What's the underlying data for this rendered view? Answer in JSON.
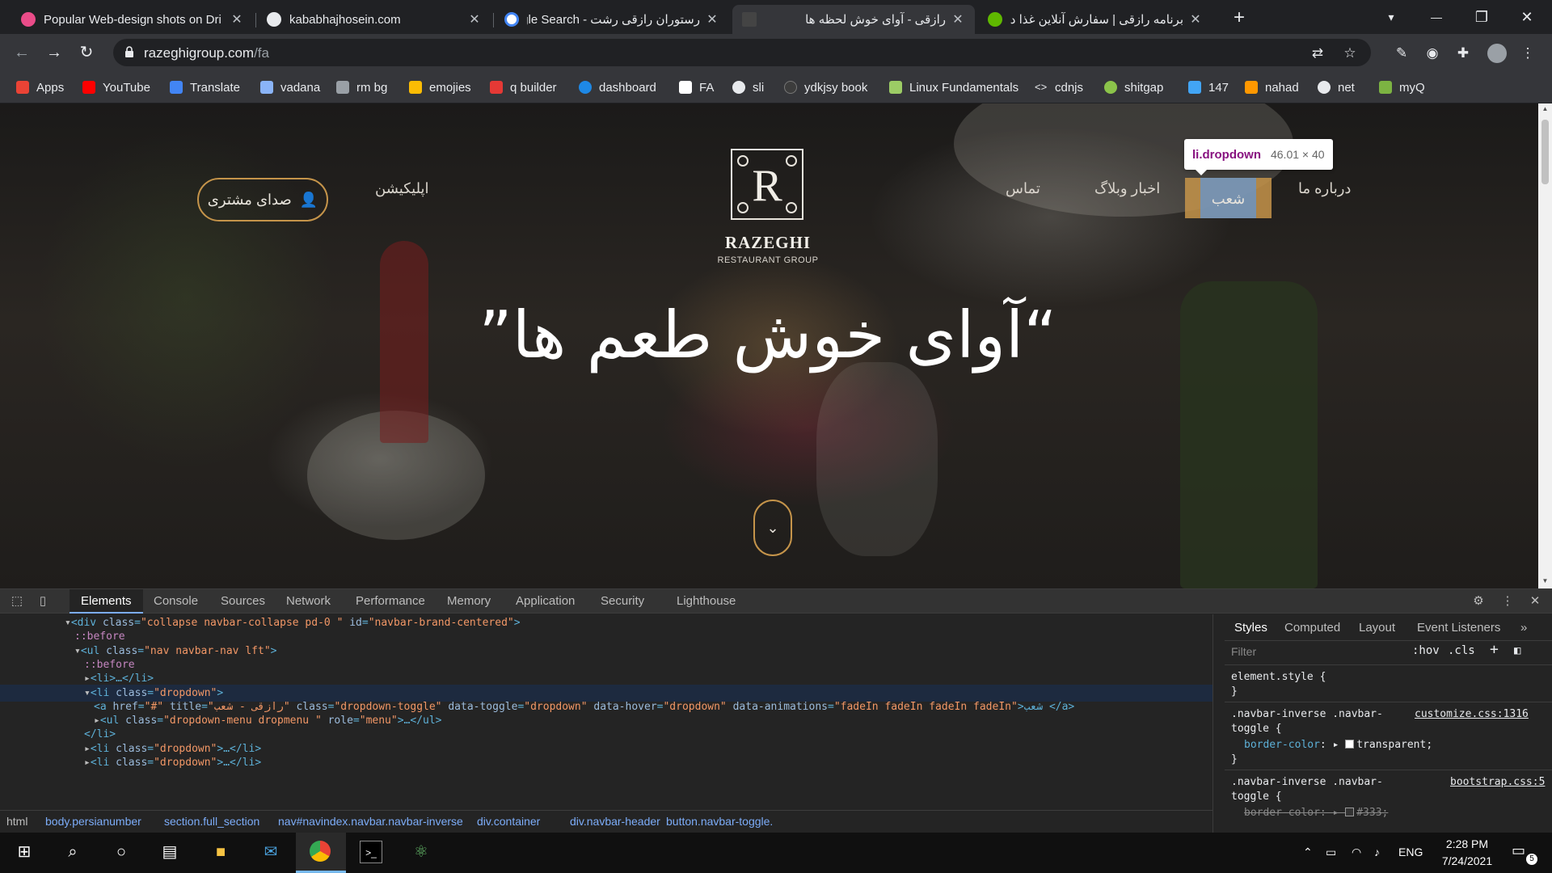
{
  "browser": {
    "tabs": [
      {
        "title": "Popular Web-design shots on Dri",
        "favicon_color": "#ea4c89",
        "active": false
      },
      {
        "title": "kababhajhosein.com",
        "favicon_color": "#e8eaed",
        "active": false
      },
      {
        "title": "رستوران رازقی رشت - Google Search",
        "favicon_color": "#4285f4",
        "active": false
      },
      {
        "title": "رازقی - آوای خوش لحظه ها",
        "favicon_color": "#444444",
        "active": true
      },
      {
        "title": "برنامه رازقی | سفارش آنلاین غذا در",
        "favicon_color": "#5fb800",
        "active": false
      }
    ],
    "close_glyph": "✕",
    "new_tab_glyph": "+",
    "window_controls": {
      "minimize": "—",
      "restore": "❐",
      "close": "✕",
      "tab_search": "▾"
    },
    "nav": {
      "back": "←",
      "forward": "→",
      "reload": "↻"
    },
    "url": {
      "host": "razeghigroup.com",
      "path": "/fa"
    },
    "bookmarks": [
      {
        "label": "Apps",
        "icon_color": "#ea4335"
      },
      {
        "label": "YouTube",
        "icon_color": "#ff0000"
      },
      {
        "label": "Translate",
        "icon_color": "#4285f4"
      },
      {
        "label": "vadana",
        "icon_color": "#8ab4f8"
      },
      {
        "label": "rm bg",
        "icon_color": "#9aa0a6"
      },
      {
        "label": "emojies",
        "icon_color": "#fbbc04"
      },
      {
        "label": "q builder",
        "icon_color": "#e53935"
      },
      {
        "label": "dashboard",
        "icon_color": "#1e88e5"
      },
      {
        "label": "FA",
        "icon_color": "#ffffff"
      },
      {
        "label": "sli",
        "icon_color": "#e8eaed"
      },
      {
        "label": "ydkjsy book",
        "icon_color": "#3c3c3c"
      },
      {
        "label": "Linux Fundamentals",
        "icon_color": "#9ccc65"
      },
      {
        "label": "cdnjs",
        "icon_color": "#e8eaed"
      },
      {
        "label": "shitgap",
        "icon_color": "#8bc34a"
      },
      {
        "label": "147",
        "icon_color": "#42a5f5"
      },
      {
        "label": "nahad",
        "icon_color": "#ff9800"
      },
      {
        "label": "net",
        "icon_color": "#e8eaed"
      },
      {
        "label": "myQ",
        "icon_color": "#7cb342"
      }
    ]
  },
  "site": {
    "menu": {
      "about": "درباره ما",
      "branches": "شعب",
      "news": "اخبار وبلاگ",
      "contact": "تماس",
      "app": "اپلیکیشن"
    },
    "customer_voice": "صدای مشتری",
    "user_icon": "👤",
    "logo_letter": "R",
    "brand_name": "RAZEGHI",
    "brand_sub": "RESTAURANT GROUP",
    "hero": "“آوای خوش طعم ها”",
    "scroll_glyph": "⌄",
    "accent_color": "#c5944a",
    "inspect_tooltip": {
      "tag": "li.dropdown",
      "size": "46.01 × 40"
    }
  },
  "devtools": {
    "tabs": [
      "Elements",
      "Console",
      "Sources",
      "Network",
      "Performance",
      "Memory",
      "Application",
      "Security",
      "Lighthouse"
    ],
    "active_tab": "Elements",
    "dom_lines": [
      {
        "indent": 0,
        "arrow": "▾",
        "tag_open": "<div ",
        "attrs": [
          [
            "class",
            "\"collapse navbar-collapse pd-0 \""
          ],
          [
            "id",
            "\"navbar-brand-centered\""
          ]
        ],
        "tail": ">",
        "pseudo": ""
      },
      {
        "indent": 1,
        "arrow": "",
        "pseudo": "::before"
      },
      {
        "indent": 1,
        "arrow": "▾",
        "tag_open": "<ul ",
        "attrs": [
          [
            "class",
            "\"nav navbar-nav lft\""
          ]
        ],
        "tail": ">",
        "pseudo": ""
      },
      {
        "indent": 2,
        "arrow": "",
        "pseudo": "::before"
      },
      {
        "indent": 2,
        "arrow": "▸",
        "raw": "<li>…</li>"
      },
      {
        "indent": 2,
        "arrow": "▾",
        "tag_open": "<li ",
        "attrs": [
          [
            "class",
            "\"dropdown\""
          ]
        ],
        "tail": ">",
        "pseudo": "",
        "selected": true
      },
      {
        "indent": 3,
        "arrow": "",
        "tag_open": "<a ",
        "attrs": [
          [
            "href",
            "\"#\""
          ],
          [
            "title",
            "\"رازقی - شعب\""
          ],
          [
            "class",
            "\"dropdown-toggle\""
          ],
          [
            "data-toggle",
            "\"dropdown\""
          ],
          [
            "data-hover",
            "\"dropdown\""
          ],
          [
            "data-animations",
            "\"fadeIn fadeIn fadeIn fadeIn\""
          ]
        ],
        "tail": ">شعب </a>",
        "pseudo": ""
      },
      {
        "indent": 3,
        "arrow": "▸",
        "tag_open": "<ul ",
        "attrs": [
          [
            "class",
            "\"dropdown-menu dropmenu \""
          ],
          [
            "role",
            "\"menu\""
          ]
        ],
        "tail": ">…</ul>",
        "pseudo": ""
      },
      {
        "indent": 2,
        "arrow": "",
        "raw": "</li>"
      },
      {
        "indent": 2,
        "arrow": "▸",
        "tag_open": "<li ",
        "attrs": [
          [
            "class",
            "\"dropdown\""
          ]
        ],
        "tail": ">…</li>",
        "pseudo": ""
      },
      {
        "indent": 2,
        "arrow": "▸",
        "tag_open": "<li ",
        "attrs": [
          [
            "class",
            "\"dropdown\""
          ]
        ],
        "tail": ">…</li>",
        "pseudo": ""
      }
    ],
    "breadcrumbs": [
      "html",
      "body.persianumber",
      "section.full_section",
      "nav#navindex.navbar.navbar-inverse",
      "div.container",
      "div.navbar-header",
      "button.navbar-toggle."
    ],
    "styles_tabs": [
      "Styles",
      "Computed",
      "Layout",
      "Event Listeners"
    ],
    "filter_placeholder": "Filter",
    "filter_hov": ":hov",
    "filter_cls": ".cls",
    "rules": {
      "element_style": "element.style {",
      "close_brace": "}",
      "rule1_selector_a": ".navbar-inverse .navbar-",
      "rule1_selector_b": "toggle {",
      "rule1_source": "customize.css:1316",
      "rule1_prop": "border-color",
      "rule1_value": "transparent;",
      "rule2_selector_a": ".navbar-inverse .navbar-",
      "rule2_selector_b": "toggle {",
      "rule2_source": "bootstrap.css:5",
      "rule2_prop": "border-color",
      "rule2_value": "#333;"
    }
  },
  "taskbar": {
    "language": "ENG",
    "time": "2:28 PM",
    "date": "7/24/2021",
    "notification_count": "5"
  }
}
